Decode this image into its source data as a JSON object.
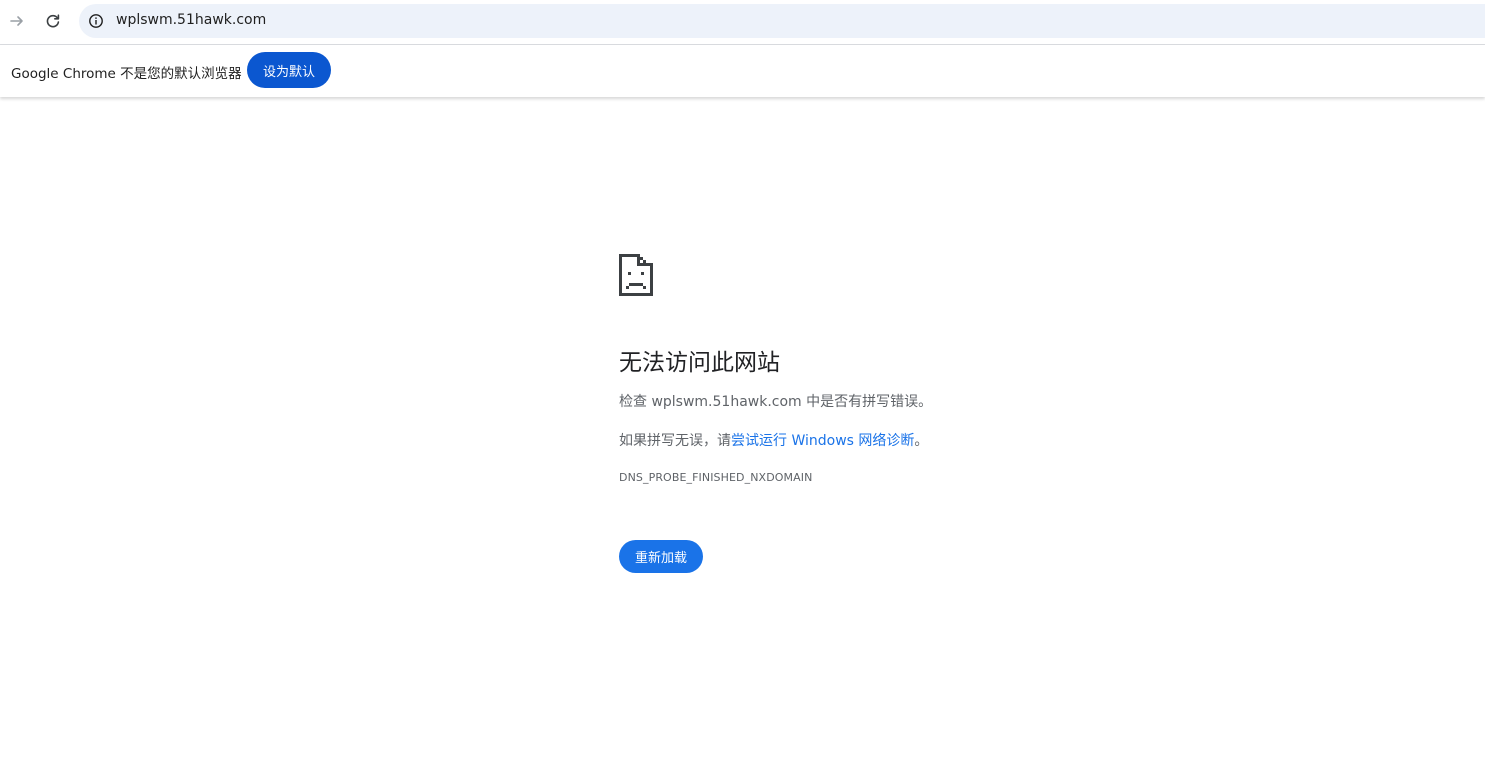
{
  "toolbar": {
    "forward_icon": "arrow-right-icon",
    "reload_icon": "reload-icon",
    "site_info_icon": "info-icon",
    "url": "wplswm.51hawk.com"
  },
  "infobar": {
    "message": "Google Chrome 不是您的默认浏览器",
    "button_label": "设为默认"
  },
  "error": {
    "icon": "sad-document-icon",
    "title": "无法访问此网站",
    "check_prefix": "检查 ",
    "check_domain": "wplswm.51hawk.com",
    "check_suffix": " 中是否有拼写错误。",
    "hint_prefix": "如果拼写无误，请",
    "hint_link": "尝试运行 Windows 网络诊断",
    "hint_suffix": "。",
    "code": "DNS_PROBE_FINISHED_NXDOMAIN",
    "reload_label": "重新加载"
  },
  "colors": {
    "omnibox_bg": "#edf2fa",
    "infobar_button": "#0b57d0",
    "link": "#1a73e8",
    "reload_button": "#1a73e8"
  }
}
